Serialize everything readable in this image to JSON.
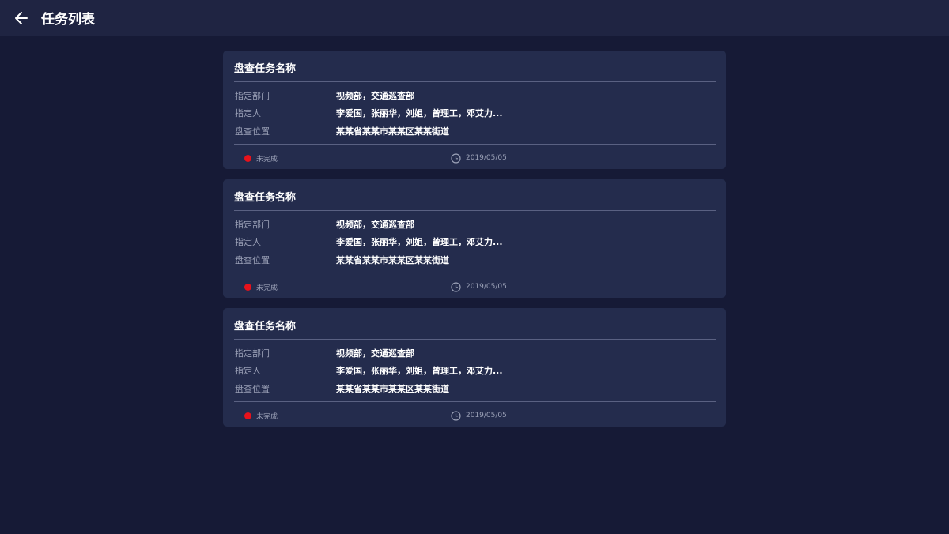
{
  "header": {
    "title": "任务列表"
  },
  "tasks": [
    {
      "title": "盘查任务名称",
      "fields": [
        {
          "label": "指定部门",
          "value": "视频部，交通巡查部"
        },
        {
          "label": "指定人",
          "value": "李爱国，张丽华，刘姐，曾理工，邓艾力..."
        },
        {
          "label": "盘查位置",
          "value": "某某省某某市某某区某某街道"
        }
      ],
      "status": "未完成",
      "status_color": "#e8121b",
      "date": "2019/05/05"
    },
    {
      "title": "盘查任务名称",
      "fields": [
        {
          "label": "指定部门",
          "value": "视频部，交通巡查部"
        },
        {
          "label": "指定人",
          "value": "李爱国，张丽华，刘姐，曾理工，邓艾力..."
        },
        {
          "label": "盘查位置",
          "value": "某某省某某市某某区某某街道"
        }
      ],
      "status": "未完成",
      "status_color": "#e8121b",
      "date": "2019/05/05"
    },
    {
      "title": "盘查任务名称",
      "fields": [
        {
          "label": "指定部门",
          "value": "视频部，交通巡查部"
        },
        {
          "label": "指定人",
          "value": "李爱国，张丽华，刘姐，曾理工，邓艾力..."
        },
        {
          "label": "盘查位置",
          "value": "某某省某某市某某区某某街道"
        }
      ],
      "status": "未完成",
      "status_color": "#e8121b",
      "date": "2019/05/05"
    }
  ],
  "icons": {
    "back": "arrow-left-icon",
    "clock": "clock-icon"
  }
}
